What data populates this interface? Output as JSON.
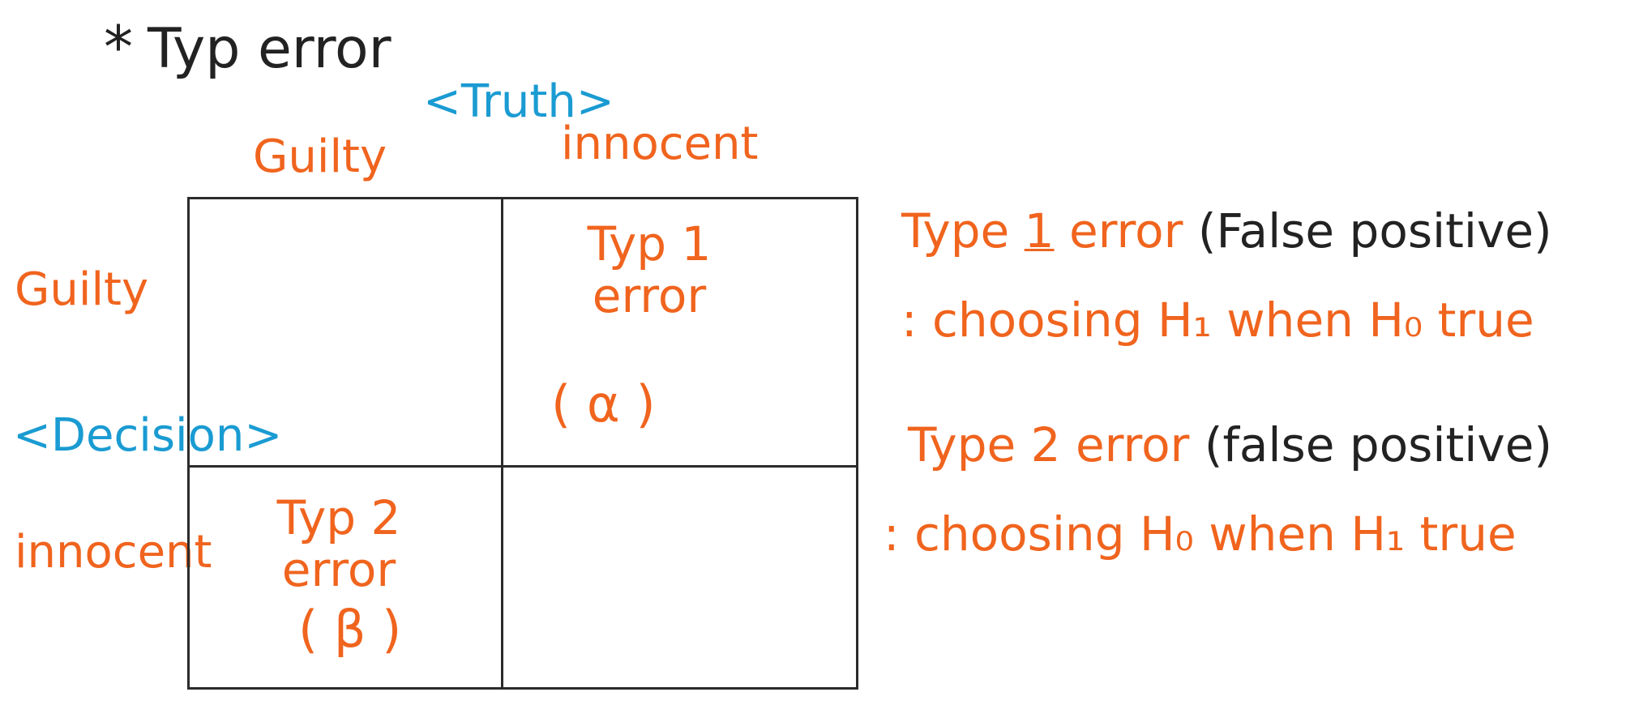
{
  "title": {
    "star": "*",
    "text": "Typ error"
  },
  "axes": {
    "truth": "<Truth>",
    "decision": "<Decision>",
    "col_guilty": "Guilty",
    "col_innocent": "innocent",
    "row_guilty": "Guilty",
    "row_innocent": "innocent"
  },
  "cells": {
    "type1": "Typ 1 error",
    "alpha": "( α )",
    "type2": "Typ 2 error",
    "beta": "( β )"
  },
  "notes": {
    "type1_head": "Type",
    "type1_num": "1",
    "type1_word": "error",
    "type1_paren": "(False positive)",
    "type1_def": ": choosing H₁ when H₀ true",
    "type2_head": "Type 2 error",
    "type2_paren": "(false positive)",
    "type2_def": ": choosing H₀ when H₁ true"
  },
  "colors": {
    "orange": "#f0641e",
    "blue": "#1a9bd2",
    "dark": "#222222"
  }
}
